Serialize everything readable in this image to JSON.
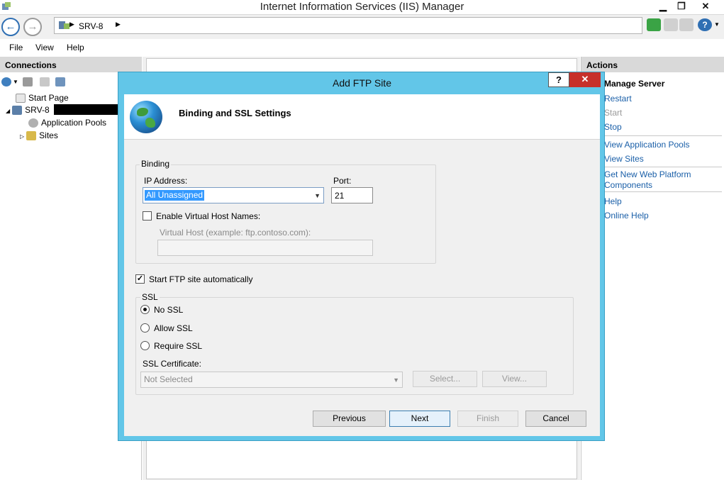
{
  "window": {
    "title": "Internet Information Services (IIS) Manager",
    "controls": {
      "minimize": "▁",
      "restore": "❐",
      "close": "✕"
    }
  },
  "address": {
    "path": "SRV-8"
  },
  "menu": [
    "File",
    "View",
    "Help"
  ],
  "connections": {
    "header": "Connections",
    "tree": {
      "start_page": "Start Page",
      "server": "SRV-8",
      "app_pools": "Application Pools",
      "sites": "Sites"
    }
  },
  "actions": {
    "header": "Actions",
    "section_title": "Manage Server",
    "restart": "Restart",
    "start": "Start",
    "stop": "Stop",
    "view_app_pools": "View Application Pools",
    "view_sites": "View Sites",
    "get_new_web_platform_1": "Get New Web Platform",
    "get_new_web_platform_2": "Components",
    "help": "Help",
    "online_help": "Online Help"
  },
  "dialog": {
    "title": "Add FTP Site",
    "help_button": "?",
    "close_button": "✕",
    "heading": "Binding and SSL Settings",
    "binding": {
      "group_label": "Binding",
      "ip_label": "IP Address:",
      "ip_value": "All Unassigned",
      "port_label": "Port:",
      "port_value": "21",
      "virtual_host_check_label": "Enable Virtual Host Names:",
      "virtual_host_label": "Virtual Host (example: ftp.contoso.com):",
      "virtual_host_value": ""
    },
    "start_auto_label": "Start FTP site automatically",
    "ssl": {
      "group_label": "SSL",
      "no_ssl": "No SSL",
      "allow_ssl": "Allow SSL",
      "require_ssl": "Require SSL",
      "cert_label": "SSL Certificate:",
      "cert_value": "Not Selected",
      "select_button": "Select...",
      "view_button": "View..."
    },
    "buttons": {
      "previous": "Previous",
      "next": "Next",
      "finish": "Finish",
      "cancel": "Cancel"
    }
  },
  "colors": {
    "dialog_frame": "#62c6e8",
    "close_red": "#c7302a",
    "link_blue": "#1a5fa8",
    "selection_blue": "#3399ff"
  }
}
